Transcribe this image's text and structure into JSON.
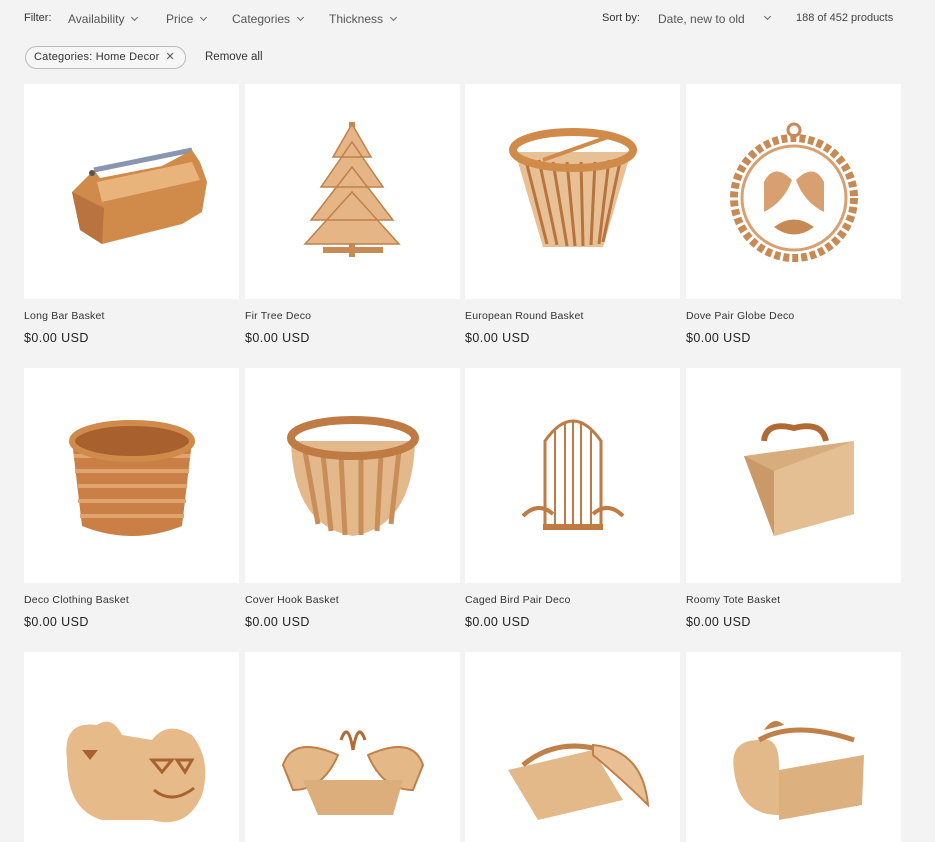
{
  "filters": {
    "label": "Filter:",
    "items": [
      "Availability",
      "Price",
      "Categories",
      "Thickness"
    ]
  },
  "sort": {
    "label": "Sort by:",
    "selected": "Date, new to old"
  },
  "count": "188 of 452 products",
  "active_filters": {
    "chip": "Categories: Home Decor",
    "remove_all": "Remove all"
  },
  "products": [
    {
      "title": "Long Bar Basket",
      "price": "$0.00 USD",
      "icon": "long-bar-basket-image"
    },
    {
      "title": "Fir Tree Deco",
      "price": "$0.00 USD",
      "icon": "fir-tree-image"
    },
    {
      "title": "European Round Basket",
      "price": "$0.00 USD",
      "icon": "round-basket-image"
    },
    {
      "title": "Dove Pair Globe Deco",
      "price": "$0.00 USD",
      "icon": "dove-globe-image"
    },
    {
      "title": "Deco Clothing Basket",
      "price": "$0.00 USD",
      "icon": "woven-basket-image"
    },
    {
      "title": "Cover Hook Basket",
      "price": "$0.00 USD",
      "icon": "hook-basket-image"
    },
    {
      "title": "Caged Bird Pair Deco",
      "price": "$0.00 USD",
      "icon": "bird-cage-image"
    },
    {
      "title": "Roomy Tote Basket",
      "price": "$0.00 USD",
      "icon": "tote-basket-image"
    },
    {
      "title": "",
      "price": "",
      "icon": "pumpkin-basket-image"
    },
    {
      "title": "",
      "price": "",
      "icon": "butterfly-basket-image"
    },
    {
      "title": "",
      "price": "",
      "icon": "banana-basket-image"
    },
    {
      "title": "",
      "price": "",
      "icon": "apple-basket-image"
    }
  ],
  "colors": {
    "background": "#f3f3f3",
    "card": "#ffffff",
    "wood": "#d9a06a",
    "wood_dark": "#b8733f"
  }
}
